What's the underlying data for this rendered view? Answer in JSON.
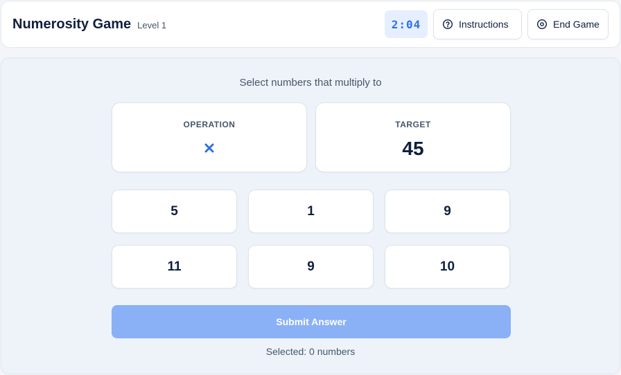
{
  "header": {
    "title": "Numerosity Game",
    "level": "Level 1",
    "timer": "2:04",
    "instructions_label": "Instructions",
    "end_game_label": "End Game"
  },
  "main": {
    "prompt": "Select numbers that multiply to",
    "operation_label": "OPERATION",
    "operation_icon": "multiply-icon",
    "target_label": "TARGET",
    "target_value": "45",
    "numbers": [
      "5",
      "1",
      "9",
      "11",
      "9",
      "10"
    ],
    "submit_label": "Submit Answer",
    "selected_text": "Selected: 0 numbers"
  },
  "colors": {
    "accent": "#2f6fe6",
    "timer_bg": "#e5efff",
    "submit_disabled": "#8ab0f6",
    "text_dark": "#0f1f3d",
    "text_muted": "#475569"
  }
}
